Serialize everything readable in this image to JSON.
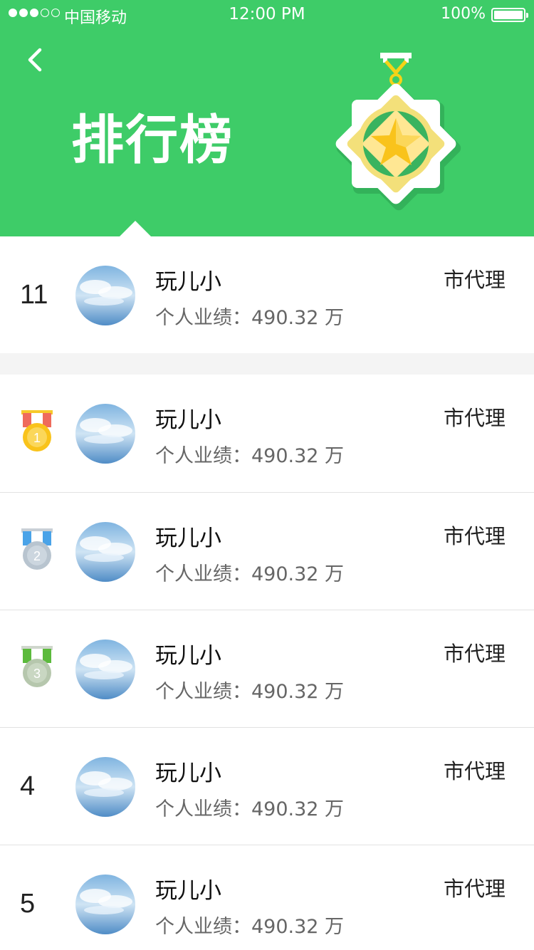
{
  "status_bar": {
    "carrier": "中国移动",
    "time": "12:00 PM",
    "battery": "100%"
  },
  "header": {
    "title": "排行榜",
    "brand_color": "#3ecc68"
  },
  "rows": [
    {
      "rank": "11",
      "medal": null,
      "name": "玩儿小",
      "performance": "个人业绩：490.32 万",
      "role": "市代理"
    },
    {
      "rank": "1",
      "medal": "gold",
      "name": "玩儿小",
      "performance": "个人业绩：490.32 万",
      "role": "市代理"
    },
    {
      "rank": "2",
      "medal": "silver",
      "name": "玩儿小",
      "performance": "个人业绩：490.32 万",
      "role": "市代理"
    },
    {
      "rank": "3",
      "medal": "bronze",
      "name": "玩儿小",
      "performance": "个人业绩：490.32 万",
      "role": "市代理"
    },
    {
      "rank": "4",
      "medal": null,
      "name": "玩儿小",
      "performance": "个人业绩：490.32 万",
      "role": "市代理"
    },
    {
      "rank": "5",
      "medal": null,
      "name": "玩儿小",
      "performance": "个人业绩：490.32 万",
      "role": "市代理"
    }
  ]
}
